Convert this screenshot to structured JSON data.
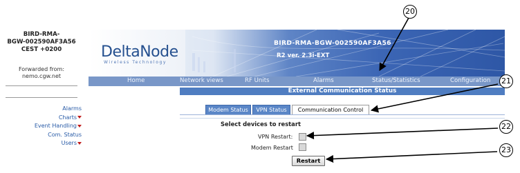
{
  "sidebar": {
    "device_lines": [
      "BIRD-RMA-",
      "BGW-002590AF3A56",
      "CEST +0200"
    ],
    "forwarded_label": "Forwarded from:",
    "forwarded_host": "nemo.cgw.net",
    "menu": [
      {
        "label": "Alarms",
        "has_arrow": false
      },
      {
        "label": "Charts",
        "has_arrow": true
      },
      {
        "label": "Event Handling",
        "has_arrow": true
      },
      {
        "label": "Com. Status",
        "has_arrow": false
      },
      {
        "label": "Users",
        "has_arrow": true
      }
    ]
  },
  "banner": {
    "logo": "DeltaNode",
    "logo_sub": "Wireless  Technology",
    "title": "BIRD-RMA-BGW-002590AF3A56",
    "version": "R2 ver. 2.3i-EXT"
  },
  "nav": [
    "Home",
    "Network views",
    "RF Units",
    "Alarms",
    "Status/Statistics",
    "Configuration"
  ],
  "section_title": "External Communication Status",
  "tabs": [
    {
      "label": "Modem Status",
      "active": false
    },
    {
      "label": "VPN Status",
      "active": false
    },
    {
      "label": "Communication Control",
      "active": true
    }
  ],
  "form": {
    "title": "Select devices to restart",
    "vpn_label": "VPN Restart:",
    "modem_label": "Modem Restart",
    "restart_button": "Restart"
  },
  "callouts": [
    "20",
    "21",
    "22",
    "23"
  ],
  "colors": {
    "nav_bg": "#7997c8",
    "subhead_bg": "#4f7dc1",
    "tab_bg": "#5a86c7",
    "link": "#2659a6",
    "arrow": "#c01b1b"
  }
}
